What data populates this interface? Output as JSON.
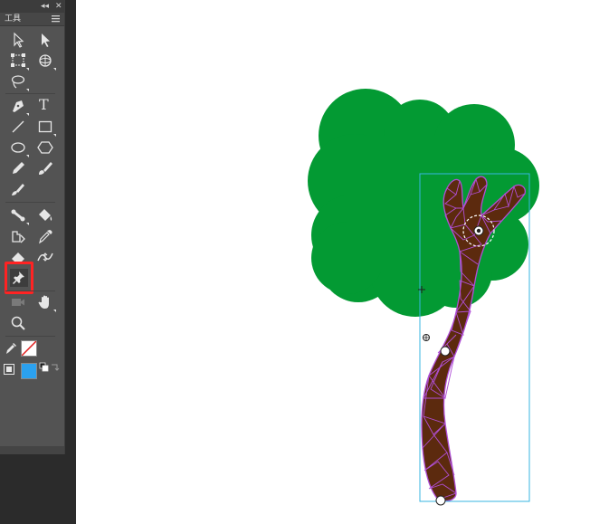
{
  "panel": {
    "title": "工具",
    "collapse_glyph": "◂◂",
    "close_glyph": "✕"
  },
  "tools": [
    {
      "name": "selection-tool-icon"
    },
    {
      "name": "subselection-tool-icon"
    },
    {
      "name": "free-transform-tool-icon"
    },
    {
      "name": "3d-rotation-tool-icon"
    },
    {
      "name": "lasso-tool-icon"
    },
    {
      "name": "pen-tool-icon"
    },
    {
      "name": "text-tool-icon",
      "label": "T"
    },
    {
      "name": "line-tool-icon"
    },
    {
      "name": "rectangle-tool-icon"
    },
    {
      "name": "oval-tool-icon"
    },
    {
      "name": "polystar-tool-icon"
    },
    {
      "name": "pencil-tool-icon"
    },
    {
      "name": "brush-tool-icon"
    },
    {
      "name": "paint-brush-tool-icon"
    },
    {
      "name": "bone-tool-icon"
    },
    {
      "name": "paint-bucket-tool-icon"
    },
    {
      "name": "ink-bottle-tool-icon"
    },
    {
      "name": "eyedropper-tool-icon"
    },
    {
      "name": "eraser-tool-icon"
    },
    {
      "name": "width-tool-icon"
    },
    {
      "name": "asset-warp-pin-tool-icon",
      "selected": true
    },
    {
      "name": "camera-tool-icon"
    },
    {
      "name": "hand-tool-icon"
    },
    {
      "name": "zoom-tool-icon"
    },
    {
      "name": "stroke-color-icon"
    },
    {
      "name": "fill-color-icon"
    }
  ],
  "colors": {
    "panel_bg": "#535353",
    "highlight": "#ff2323",
    "foliage": "#039a33",
    "trunk": "#5c2a0e",
    "mesh": "#b04fd6",
    "bbox": "#37b6e0",
    "fill_swatch": "#2ba1ef"
  }
}
